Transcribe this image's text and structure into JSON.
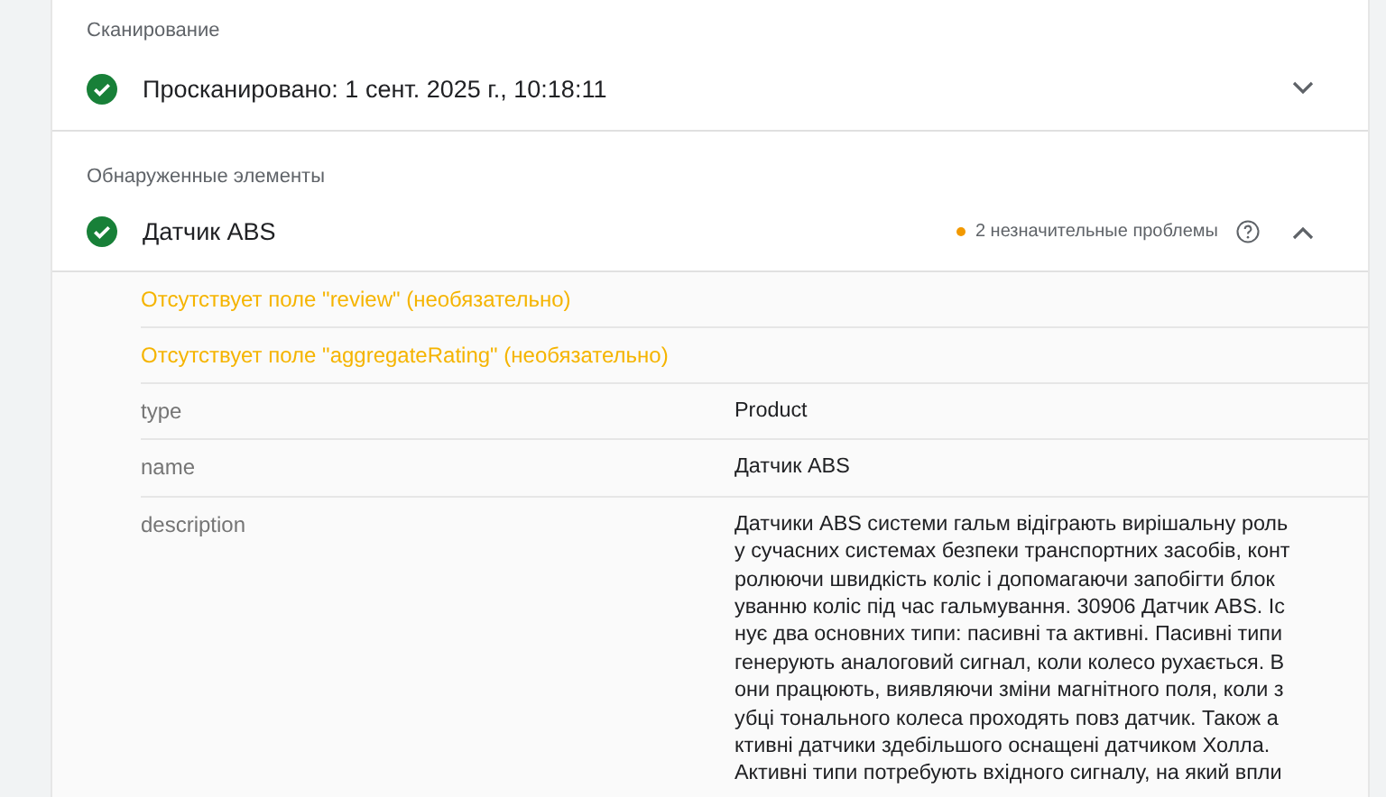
{
  "crawl_section": {
    "heading": "Сканирование",
    "valid": true,
    "text": "Просканировано: 1 сент. 2025 г., 10:18:11",
    "expanded": false
  },
  "detected_section": {
    "heading": "Обнаруженные элементы",
    "item": {
      "valid": true,
      "name": "Датчик ABS",
      "issues": "2 незначительные проблемы",
      "color": "#f29900",
      "expanded": true
    },
    "warnings": [
      "Отсутствует поле \"review\" (необязательно)",
      "Отсутствует поле \"aggregateRating\" (необязательно)"
    ],
    "fields": [
      {
        "key": "type",
        "value_lines": [
          "Product"
        ]
      },
      {
        "key": "name",
        "value_lines": [
          "Датчик ABS"
        ]
      },
      {
        "key": "description",
        "value_lines": [
          "Датчики ABS системи гальм відіграють вирішальну роль",
          "у сучасних системах безпеки транспортних засобів, конт",
          "ролюючи швидкість коліс і допомагаючи запобігти блок",
          "уванню коліс під час гальмування. 30906 Датчик ABS. Іс",
          "нує два основних типи: пасивні та активні. Пасивні типи",
          "генерують аналоговий сигнал, коли колесо рухається. В",
          "они працюють, виявляючи зміни магнітного поля, коли з",
          "убці тонального колеса проходять повз датчик. Також а",
          "ктивні датчики здебільшого оснащені датчиком Холла.",
          "Активні типи потребують вхідного сигналу, на який впли"
        ]
      }
    ]
  }
}
